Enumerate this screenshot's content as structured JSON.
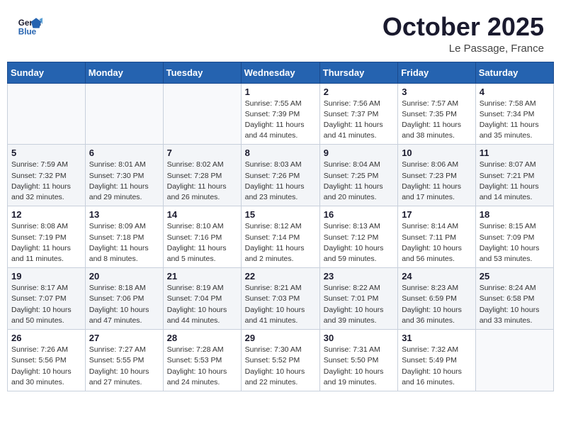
{
  "header": {
    "logo_line1": "General",
    "logo_line2": "Blue",
    "month": "October 2025",
    "location": "Le Passage, France"
  },
  "days_of_week": [
    "Sunday",
    "Monday",
    "Tuesday",
    "Wednesday",
    "Thursday",
    "Friday",
    "Saturday"
  ],
  "weeks": [
    [
      {
        "day": "",
        "sunrise": "",
        "sunset": "",
        "daylight": ""
      },
      {
        "day": "",
        "sunrise": "",
        "sunset": "",
        "daylight": ""
      },
      {
        "day": "",
        "sunrise": "",
        "sunset": "",
        "daylight": ""
      },
      {
        "day": "1",
        "sunrise": "Sunrise: 7:55 AM",
        "sunset": "Sunset: 7:39 PM",
        "daylight": "Daylight: 11 hours and 44 minutes."
      },
      {
        "day": "2",
        "sunrise": "Sunrise: 7:56 AM",
        "sunset": "Sunset: 7:37 PM",
        "daylight": "Daylight: 11 hours and 41 minutes."
      },
      {
        "day": "3",
        "sunrise": "Sunrise: 7:57 AM",
        "sunset": "Sunset: 7:35 PM",
        "daylight": "Daylight: 11 hours and 38 minutes."
      },
      {
        "day": "4",
        "sunrise": "Sunrise: 7:58 AM",
        "sunset": "Sunset: 7:34 PM",
        "daylight": "Daylight: 11 hours and 35 minutes."
      }
    ],
    [
      {
        "day": "5",
        "sunrise": "Sunrise: 7:59 AM",
        "sunset": "Sunset: 7:32 PM",
        "daylight": "Daylight: 11 hours and 32 minutes."
      },
      {
        "day": "6",
        "sunrise": "Sunrise: 8:01 AM",
        "sunset": "Sunset: 7:30 PM",
        "daylight": "Daylight: 11 hours and 29 minutes."
      },
      {
        "day": "7",
        "sunrise": "Sunrise: 8:02 AM",
        "sunset": "Sunset: 7:28 PM",
        "daylight": "Daylight: 11 hours and 26 minutes."
      },
      {
        "day": "8",
        "sunrise": "Sunrise: 8:03 AM",
        "sunset": "Sunset: 7:26 PM",
        "daylight": "Daylight: 11 hours and 23 minutes."
      },
      {
        "day": "9",
        "sunrise": "Sunrise: 8:04 AM",
        "sunset": "Sunset: 7:25 PM",
        "daylight": "Daylight: 11 hours and 20 minutes."
      },
      {
        "day": "10",
        "sunrise": "Sunrise: 8:06 AM",
        "sunset": "Sunset: 7:23 PM",
        "daylight": "Daylight: 11 hours and 17 minutes."
      },
      {
        "day": "11",
        "sunrise": "Sunrise: 8:07 AM",
        "sunset": "Sunset: 7:21 PM",
        "daylight": "Daylight: 11 hours and 14 minutes."
      }
    ],
    [
      {
        "day": "12",
        "sunrise": "Sunrise: 8:08 AM",
        "sunset": "Sunset: 7:19 PM",
        "daylight": "Daylight: 11 hours and 11 minutes."
      },
      {
        "day": "13",
        "sunrise": "Sunrise: 8:09 AM",
        "sunset": "Sunset: 7:18 PM",
        "daylight": "Daylight: 11 hours and 8 minutes."
      },
      {
        "day": "14",
        "sunrise": "Sunrise: 8:10 AM",
        "sunset": "Sunset: 7:16 PM",
        "daylight": "Daylight: 11 hours and 5 minutes."
      },
      {
        "day": "15",
        "sunrise": "Sunrise: 8:12 AM",
        "sunset": "Sunset: 7:14 PM",
        "daylight": "Daylight: 11 hours and 2 minutes."
      },
      {
        "day": "16",
        "sunrise": "Sunrise: 8:13 AM",
        "sunset": "Sunset: 7:12 PM",
        "daylight": "Daylight: 10 hours and 59 minutes."
      },
      {
        "day": "17",
        "sunrise": "Sunrise: 8:14 AM",
        "sunset": "Sunset: 7:11 PM",
        "daylight": "Daylight: 10 hours and 56 minutes."
      },
      {
        "day": "18",
        "sunrise": "Sunrise: 8:15 AM",
        "sunset": "Sunset: 7:09 PM",
        "daylight": "Daylight: 10 hours and 53 minutes."
      }
    ],
    [
      {
        "day": "19",
        "sunrise": "Sunrise: 8:17 AM",
        "sunset": "Sunset: 7:07 PM",
        "daylight": "Daylight: 10 hours and 50 minutes."
      },
      {
        "day": "20",
        "sunrise": "Sunrise: 8:18 AM",
        "sunset": "Sunset: 7:06 PM",
        "daylight": "Daylight: 10 hours and 47 minutes."
      },
      {
        "day": "21",
        "sunrise": "Sunrise: 8:19 AM",
        "sunset": "Sunset: 7:04 PM",
        "daylight": "Daylight: 10 hours and 44 minutes."
      },
      {
        "day": "22",
        "sunrise": "Sunrise: 8:21 AM",
        "sunset": "Sunset: 7:03 PM",
        "daylight": "Daylight: 10 hours and 41 minutes."
      },
      {
        "day": "23",
        "sunrise": "Sunrise: 8:22 AM",
        "sunset": "Sunset: 7:01 PM",
        "daylight": "Daylight: 10 hours and 39 minutes."
      },
      {
        "day": "24",
        "sunrise": "Sunrise: 8:23 AM",
        "sunset": "Sunset: 6:59 PM",
        "daylight": "Daylight: 10 hours and 36 minutes."
      },
      {
        "day": "25",
        "sunrise": "Sunrise: 8:24 AM",
        "sunset": "Sunset: 6:58 PM",
        "daylight": "Daylight: 10 hours and 33 minutes."
      }
    ],
    [
      {
        "day": "26",
        "sunrise": "Sunrise: 7:26 AM",
        "sunset": "Sunset: 5:56 PM",
        "daylight": "Daylight: 10 hours and 30 minutes."
      },
      {
        "day": "27",
        "sunrise": "Sunrise: 7:27 AM",
        "sunset": "Sunset: 5:55 PM",
        "daylight": "Daylight: 10 hours and 27 minutes."
      },
      {
        "day": "28",
        "sunrise": "Sunrise: 7:28 AM",
        "sunset": "Sunset: 5:53 PM",
        "daylight": "Daylight: 10 hours and 24 minutes."
      },
      {
        "day": "29",
        "sunrise": "Sunrise: 7:30 AM",
        "sunset": "Sunset: 5:52 PM",
        "daylight": "Daylight: 10 hours and 22 minutes."
      },
      {
        "day": "30",
        "sunrise": "Sunrise: 7:31 AM",
        "sunset": "Sunset: 5:50 PM",
        "daylight": "Daylight: 10 hours and 19 minutes."
      },
      {
        "day": "31",
        "sunrise": "Sunrise: 7:32 AM",
        "sunset": "Sunset: 5:49 PM",
        "daylight": "Daylight: 10 hours and 16 minutes."
      },
      {
        "day": "",
        "sunrise": "",
        "sunset": "",
        "daylight": ""
      }
    ]
  ]
}
